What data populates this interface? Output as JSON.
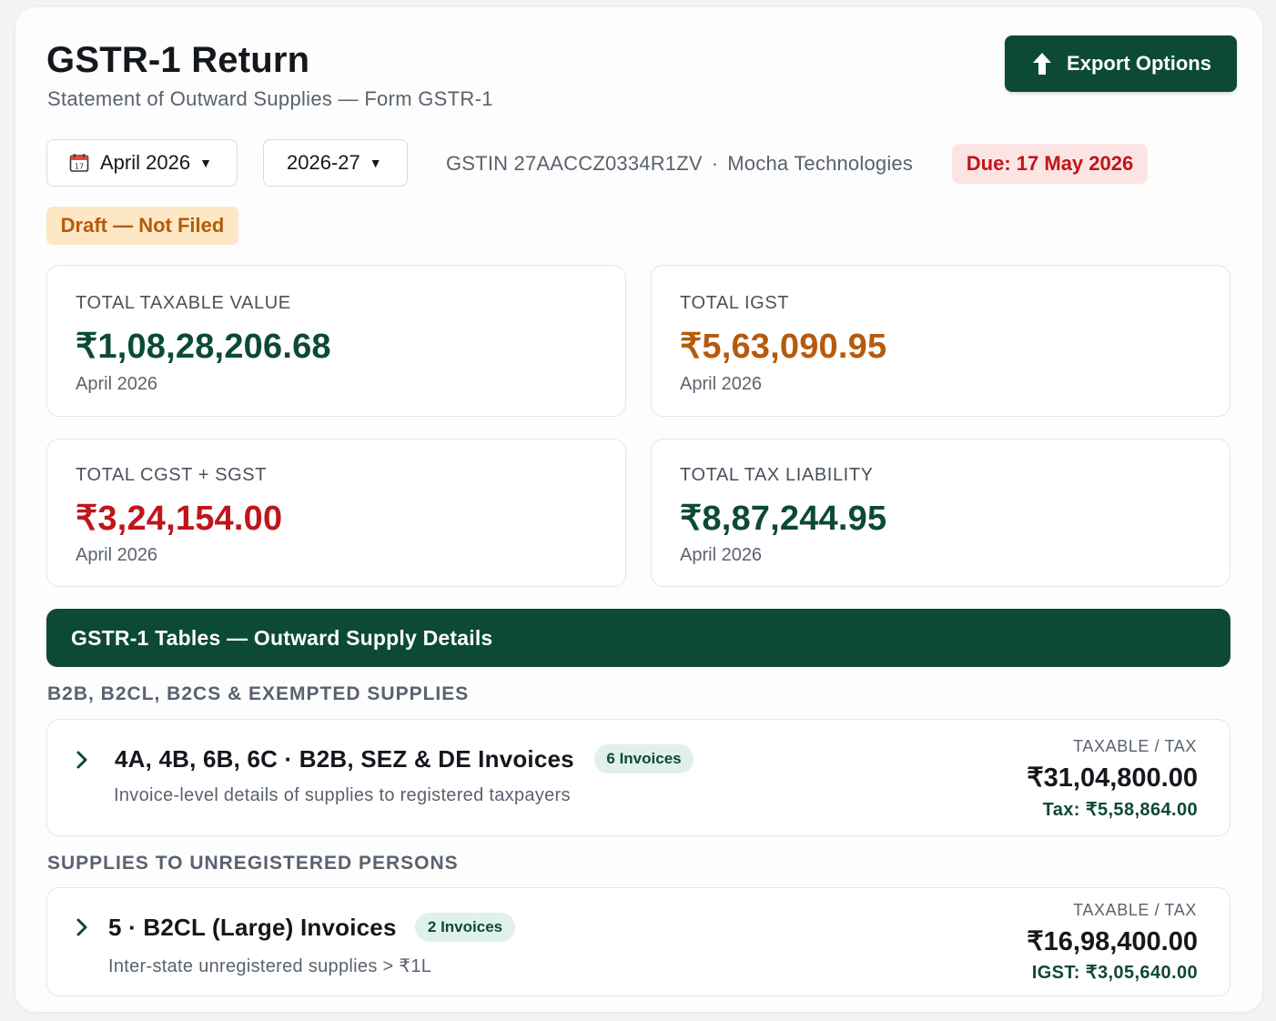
{
  "header": {
    "title": "GSTR-1 Return",
    "subtitle": "Statement of Outward Supplies — Form GSTR-1",
    "export_label": "Export Options"
  },
  "filters": {
    "month": "April 2026",
    "fiscal_year": "2026-27",
    "gstin": "GSTIN 27AACCZ0334R1ZV",
    "separator": "·",
    "company": "Mocha Technologies",
    "due": "Due: 17 May 2026",
    "status": "Draft — Not Filed"
  },
  "summary_cards": [
    {
      "label": "TOTAL TAXABLE VALUE",
      "value": "₹1,08,28,206.68",
      "period": "April 2026",
      "color": "#0c4a34"
    },
    {
      "label": "TOTAL IGST",
      "value": "₹5,63,090.95",
      "period": "April 2026",
      "color": "#b65a0b"
    },
    {
      "label": "TOTAL CGST + SGST",
      "value": "₹3,24,154.00",
      "period": "April 2026",
      "color": "#c0151b"
    },
    {
      "label": "TOTAL TAX LIABILITY",
      "value": "₹8,87,244.95",
      "period": "April 2026",
      "color": "#0c4a34"
    }
  ],
  "tables": {
    "banner": "GSTR-1 Tables — Outward Supply Details",
    "sections": [
      {
        "title": "B2B, B2CL, B2CS & EXEMPTED SUPPLIES",
        "rows": [
          {
            "title": "4A, 4B, 6B, 6C · B2B, SEZ & DE Invoices",
            "pill": "6 Invoices",
            "description": "Invoice-level details of supplies to registered taxpayers",
            "amount_label": "TAXABLE / TAX",
            "taxable": "₹31,04,800.00",
            "tax": "Tax: ₹5,58,864.00"
          }
        ]
      },
      {
        "title": "SUPPLIES TO UNREGISTERED PERSONS",
        "rows": [
          {
            "title": "5 · B2CL (Large) Invoices",
            "pill": "2 Invoices",
            "description": "Inter-state unregistered supplies > ₹1L",
            "amount_label": "TAXABLE / TAX",
            "taxable": "₹16,98,400.00",
            "tax": "IGST: ₹3,05,640.00"
          }
        ]
      }
    ]
  },
  "icons": {
    "export": "upload-arrow-icon",
    "calendar": "calendar-icon",
    "dropdown": "caret-down-icon",
    "expand": "chevron-right-icon"
  },
  "colors": {
    "brand_green": "#0c4a34",
    "igst_orange": "#b65a0b",
    "alert_red": "#c0151b",
    "due_bg": "#fde4e4",
    "draft_bg": "#fde7c4",
    "pill_bg": "#dff1e8"
  }
}
